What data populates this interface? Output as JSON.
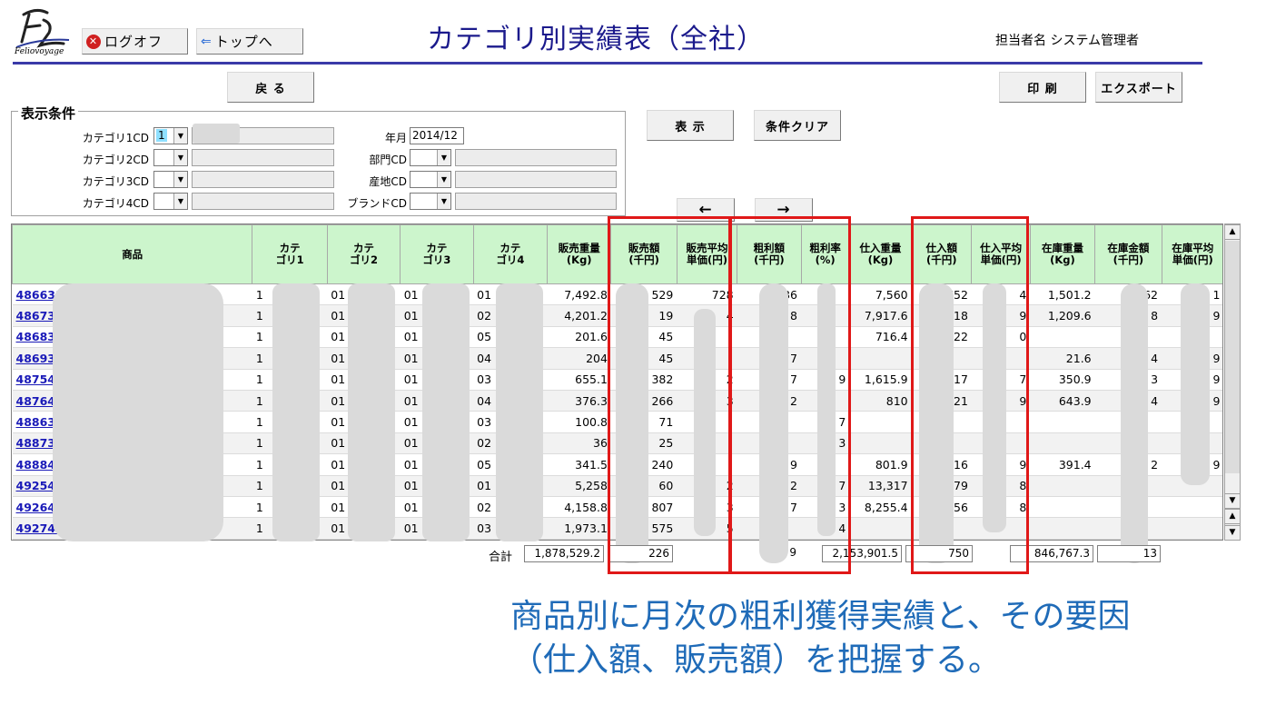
{
  "header": {
    "logo_text": "Feliovoyage",
    "logoff_label": "ログオフ",
    "top_label": "トップへ",
    "title": "カテゴリ別実績表（全社）",
    "user_label": "担当者名",
    "user_name": "システム管理者"
  },
  "toolbar": {
    "back_label": "戻 る",
    "print_label": "印 刷",
    "export_label": "エクスポート",
    "show_label": "表 示",
    "clear_label": "条件クリア",
    "prev_label": "←",
    "next_label": "→"
  },
  "conditions": {
    "legend": "表示条件",
    "cat1_label": "カテゴリ1CD",
    "cat1_value": "1",
    "cat2_label": "カテゴリ2CD",
    "cat3_label": "カテゴリ3CD",
    "cat4_label": "カテゴリ4CD",
    "month_label": "年月",
    "month_value": "2014/12",
    "dept_label": "部門CD",
    "origin_label": "産地CD",
    "brand_label": "ブランドCD"
  },
  "table": {
    "headers": [
      "商品",
      "カテ\nゴリ1",
      "カテ\nゴリ2",
      "カテ\nゴリ3",
      "カテ\nゴリ4",
      "販売重量\n(Kg)",
      "販売額\n(千円)",
      "販売平均\n単価(円)",
      "粗利額\n(千円)",
      "粗利率\n(%)",
      "仕入重量\n(Kg)",
      "仕入額\n(千円)",
      "仕入平均\n単価(円)",
      "在庫重量\n(Kg)",
      "在庫金額\n(千円)",
      "在庫平均\n単価(円)"
    ],
    "rows": [
      [
        "486631",
        "1",
        "01",
        "01",
        "01",
        "7,492.8",
        "529",
        "728",
        "836",
        "",
        "7,560",
        "5,752",
        "4",
        "1,501.2",
        "162",
        "1"
      ],
      [
        "486731",
        "1",
        "01",
        "01",
        "02",
        "4,201.2",
        "19",
        "4",
        "8",
        "",
        "7,917.6",
        "18",
        "9",
        "1,209.6",
        "8",
        "9"
      ],
      [
        "486831",
        "1",
        "01",
        "01",
        "05",
        "201.6",
        "45",
        "",
        "",
        "",
        "716.4",
        "22",
        "0",
        "",
        "",
        ""
      ],
      [
        "486931",
        "1",
        "01",
        "01",
        "04",
        "204",
        "45",
        "",
        "7",
        "",
        "",
        "",
        "",
        "21.6",
        "4",
        "9"
      ],
      [
        "487541",
        "1",
        "01",
        "01",
        "03",
        "655.1",
        "382",
        "2",
        "7",
        "9",
        "1,615.9",
        "17",
        "7",
        "350.9",
        "3",
        "9"
      ],
      [
        "487641",
        "1",
        "01",
        "01",
        "04",
        "376.3",
        "266",
        "3",
        "2",
        "",
        "810",
        "21",
        "9",
        "643.9",
        "4",
        "9"
      ],
      [
        "488639",
        "1",
        "01",
        "01",
        "03",
        "100.8",
        "71",
        "",
        "",
        "7",
        "",
        "",
        "",
        "",
        "",
        ""
      ],
      [
        "488739",
        "1",
        "01",
        "01",
        "02",
        "36",
        "25",
        "",
        "",
        "3",
        "",
        "",
        "",
        "",
        "",
        ""
      ],
      [
        "488841",
        "1",
        "01",
        "01",
        "05",
        "341.5",
        "240",
        "",
        "9",
        "",
        "801.9",
        "16",
        "9",
        "391.4",
        "2",
        "9"
      ],
      [
        "492541",
        "1",
        "01",
        "01",
        "01",
        "5,258",
        "60",
        "2",
        "2",
        "7",
        "13,317",
        "79",
        "8",
        "",
        "",
        ""
      ],
      [
        "492641",
        "1",
        "01",
        "01",
        "02",
        "4,158.8",
        "807",
        "3",
        "7",
        "3",
        "8,255.4",
        "56",
        "8",
        "",
        "",
        ""
      ],
      [
        "492741",
        "1",
        "01",
        "01",
        "03",
        "1,973.1",
        "575",
        "5",
        "",
        "4",
        "",
        "",
        "",
        "",
        "",
        ""
      ]
    ]
  },
  "totals": {
    "label": "合計",
    "sales_weight": "1,878,529.2",
    "sales_amount": "226",
    "gross_profit": "9",
    "purchase_weight": "2,153,901.5",
    "purchase_amount": "750",
    "stock_weight": "846,767.3",
    "stock_amount": "13"
  },
  "caption": {
    "line1": "商品別に月次の粗利獲得実績と、その要因",
    "line2": "（仕入額、販売額）を把握する。"
  },
  "colors": {
    "header_bg": "#ccf5cc",
    "title": "#1b1a8c",
    "link": "#1a1ab8",
    "highlight": "#e01818",
    "caption": "#1f6bb8"
  }
}
